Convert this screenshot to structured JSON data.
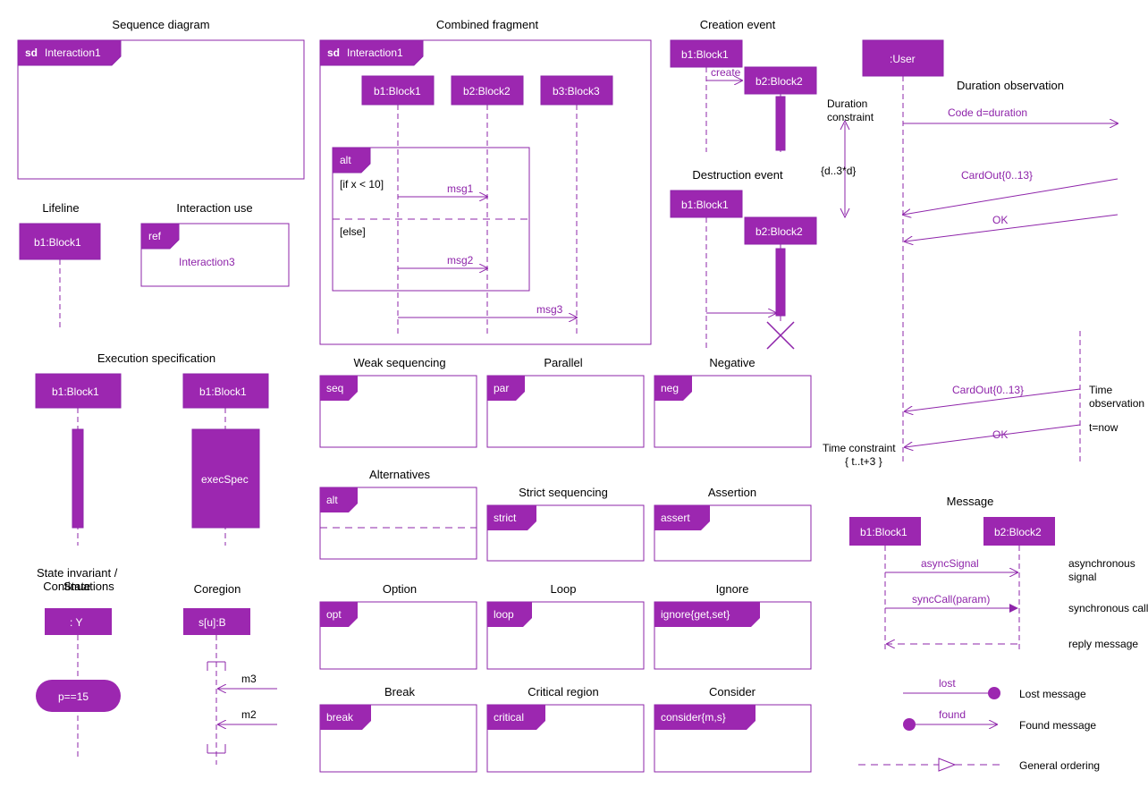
{
  "colors": {
    "purple": "#9c27b0",
    "dark_purple": "#8e24aa",
    "white": "#ffffff"
  },
  "titles": {
    "sequence_diagram": "Sequence diagram",
    "combined_fragment": "Combined fragment",
    "creation_event": "Creation event",
    "lifeline": "Lifeline",
    "interaction_use": "Interaction use",
    "destruction_event": "Destruction event",
    "execution_specification": "Execution specification",
    "weak_sequencing": "Weak sequencing",
    "parallel": "Parallel",
    "negative": "Negative",
    "alternatives": "Alternatives",
    "strict_sequencing": "Strict sequencing",
    "assertion": "Assertion",
    "option": "Option",
    "loop": "Loop",
    "ignore": "Ignore",
    "break": "Break",
    "critical_region": "Critical region",
    "consider": "Consider",
    "state_invariant": "State invariant /\nContinuations",
    "coregion": "Coregion",
    "duration_observation": "Duration observation",
    "time_observation": "Time\nobservation",
    "message": "Message",
    "duration_constraint": "Duration\nconstraint",
    "time_constraint": "Time constraint"
  },
  "labels": {
    "sd": "sd",
    "interaction1": "Interaction1",
    "b1_block1": "b1:Block1",
    "b2_block2": "b2:Block2",
    "b3_block3": "b3:Block3",
    "ref": "ref",
    "interaction3": "Interaction3",
    "alt": "alt",
    "if_x": "[if x < 10]",
    "else": "[else]",
    "msg1": "msg1",
    "msg2": "msg2",
    "msg3": "msg3",
    "create": "create",
    "user": ":User",
    "code_d": "Code d=duration",
    "d_3d": "{d..3*d}",
    "cardout": "CardOut{0..13}",
    "ok": "OK",
    "t_now": "t=now",
    "t_t3": "{ t..t+3 }",
    "exec_spec": "execSpec",
    "seq": "seq",
    "par": "par",
    "neg": "neg",
    "strict": "strict",
    "assert": "assert",
    "opt": "opt",
    "loop": "loop",
    "ignore_gs": "ignore{get,set}",
    "break": "break",
    "critical": "critical",
    "consider_ms": "consider{m,s}",
    "y": ": Y",
    "p15": "p==15",
    "sub": "s[u]:B",
    "m3": "m3",
    "m2": "m2",
    "async_signal": "asyncSignal",
    "sync_call": "syncCall(param)",
    "async_signal_desc": "asynchronous\nsignal",
    "sync_call_desc": "synchronous call",
    "reply_msg": "reply message",
    "lost": "lost",
    "found": "found",
    "lost_msg": "Lost message",
    "found_msg": "Found message",
    "general_ordering": "General ordering"
  }
}
